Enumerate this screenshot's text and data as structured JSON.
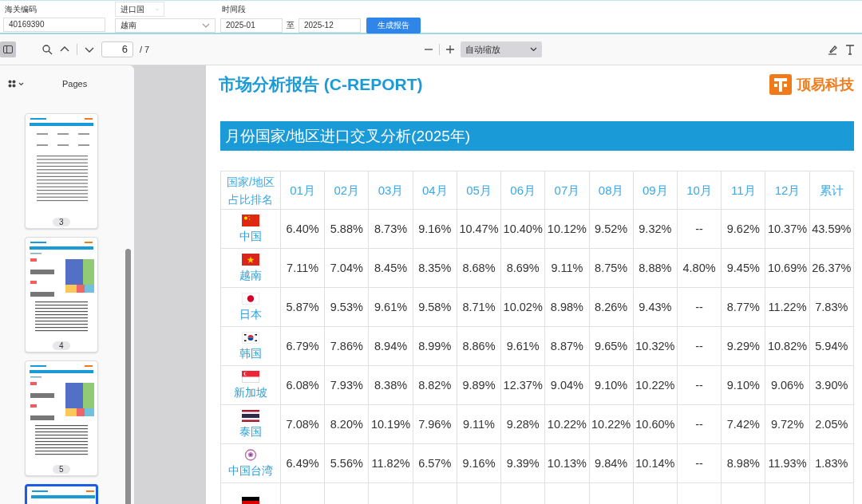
{
  "query_form": {
    "hs_code": {
      "label": "海关编码",
      "value": "40169390"
    },
    "country": {
      "label": "进口国",
      "value": "越南"
    },
    "period": {
      "label": "时间段",
      "from": "2025-01",
      "separator": "至",
      "to": "2025-12"
    },
    "submit": "生成报告"
  },
  "viewer_toolbar": {
    "sidebar_toggle_on": true,
    "page": "6",
    "page_total": "/ 7",
    "zoom": "自动缩放"
  },
  "sidebar": {
    "title": "Pages",
    "thumbnails": [
      {
        "kind": "table",
        "label": "3",
        "selected": false
      },
      {
        "kind": "treemap",
        "label": "4",
        "selected": false
      },
      {
        "kind": "treemap",
        "label": "5",
        "selected": false
      },
      {
        "kind": "table",
        "selected": true
      }
    ]
  },
  "document": {
    "title": "市场分析报告 (C-REPORT)",
    "brand": "顶易科技",
    "section_title": "月份国家/地区进口交叉分析(2025年)",
    "table": {
      "columns": [
        "国家/地区占比排名",
        "01月",
        "02月",
        "03月",
        "04月",
        "05月",
        "06月",
        "07月",
        "08月",
        "09月",
        "10月",
        "11月",
        "12月",
        "累计"
      ],
      "rows": [
        {
          "kind": "china",
          "name": "中国",
          "cells": [
            "6.40%",
            "5.88%",
            "8.73%",
            "9.16%",
            "10.47%",
            "10.40%",
            "10.12%",
            "9.52%",
            "9.32%",
            "--",
            "9.62%",
            "10.37%",
            "43.59%"
          ]
        },
        {
          "kind": "vietnam",
          "name": "越南",
          "cells": [
            "7.11%",
            "7.04%",
            "8.45%",
            "8.35%",
            "8.68%",
            "8.69%",
            "9.11%",
            "8.75%",
            "8.88%",
            "4.80%",
            "9.45%",
            "10.69%",
            "26.37%"
          ]
        },
        {
          "kind": "japan",
          "name": "日本",
          "cells": [
            "5.87%",
            "9.53%",
            "9.61%",
            "9.58%",
            "8.71%",
            "10.02%",
            "8.98%",
            "8.26%",
            "9.43%",
            "--",
            "8.77%",
            "11.22%",
            "7.83%"
          ]
        },
        {
          "kind": "korea",
          "name": "韩国",
          "cells": [
            "6.79%",
            "7.86%",
            "8.94%",
            "8.99%",
            "8.86%",
            "9.61%",
            "8.87%",
            "9.65%",
            "10.32%",
            "--",
            "9.29%",
            "10.82%",
            "5.94%"
          ]
        },
        {
          "kind": "singapore",
          "name": "新加坡",
          "cells": [
            "6.08%",
            "7.93%",
            "8.38%",
            "8.82%",
            "9.89%",
            "12.37%",
            "9.04%",
            "9.10%",
            "10.22%",
            "--",
            "9.10%",
            "9.06%",
            "3.90%"
          ]
        },
        {
          "kind": "thailand",
          "name": "泰国",
          "cells": [
            "7.08%",
            "8.20%",
            "10.19%",
            "7.96%",
            "9.11%",
            "9.28%",
            "10.22%",
            "10.22%",
            "10.60%",
            "--",
            "7.42%",
            "9.72%",
            "2.05%"
          ]
        },
        {
          "kind": "emblem",
          "name": "中国台湾",
          "cells": [
            "6.49%",
            "5.56%",
            "11.82%",
            "6.57%",
            "9.16%",
            "9.39%",
            "10.13%",
            "9.84%",
            "10.14%",
            "--",
            "8.98%",
            "11.93%",
            "1.83%"
          ]
        },
        {
          "kind": "germany"
        }
      ]
    }
  }
}
